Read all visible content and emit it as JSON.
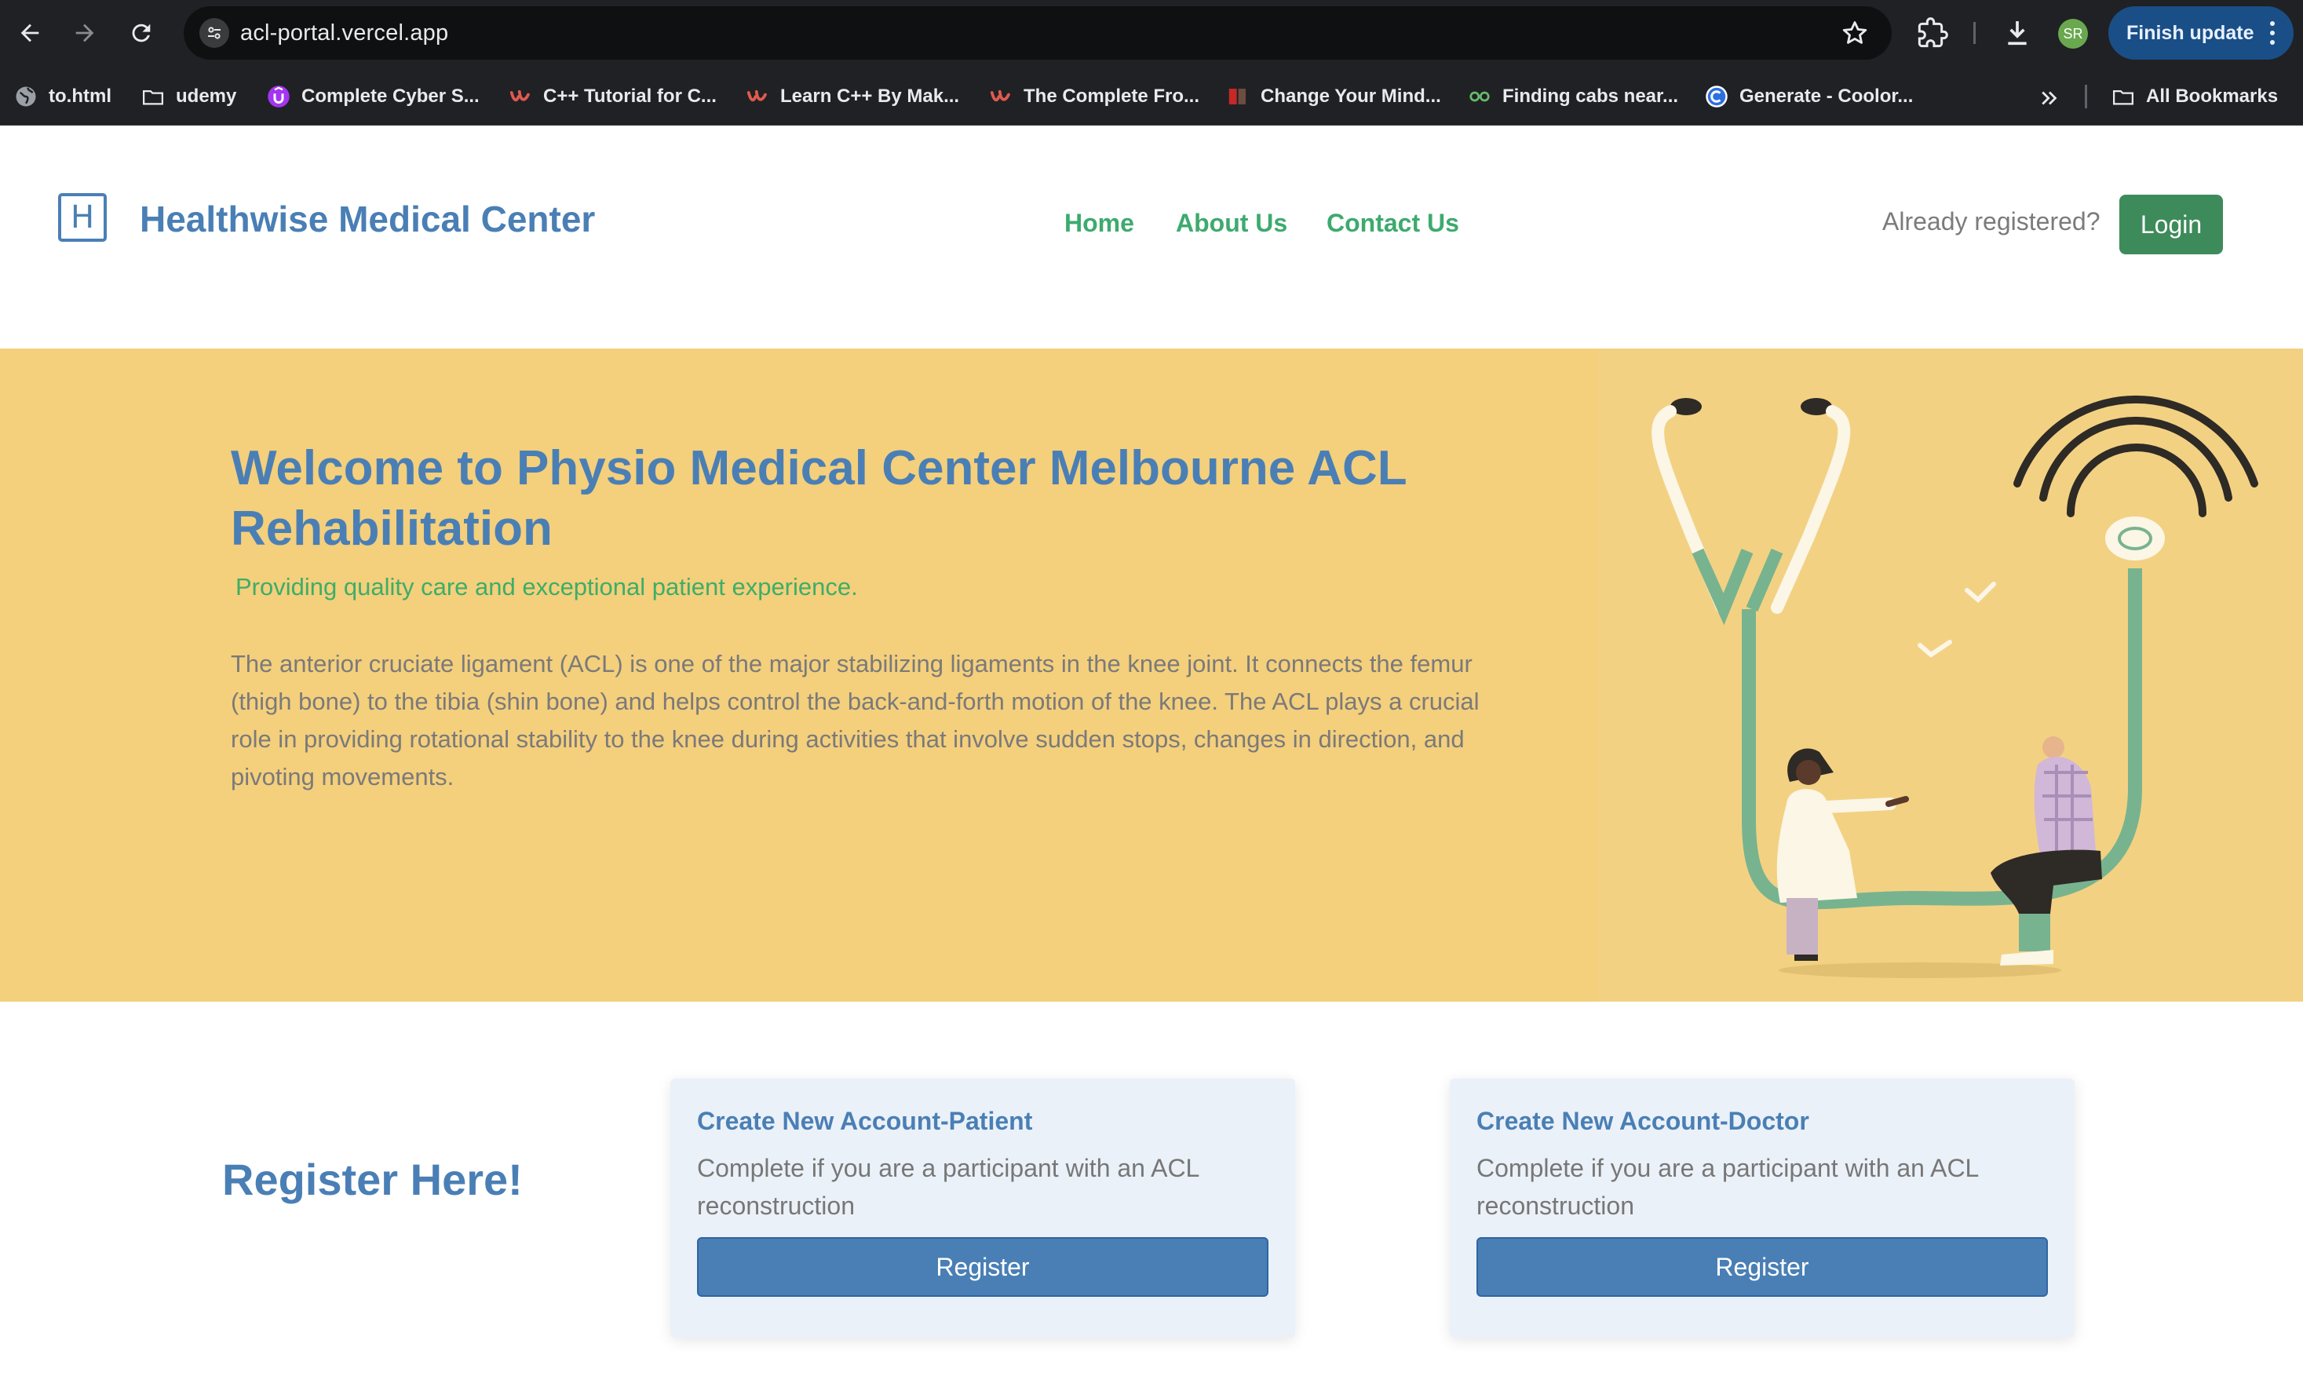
{
  "browser": {
    "url": "acl-portal.vercel.app",
    "profile_initials": "SR",
    "update_button": "Finish update",
    "icons": [
      "back-arrow-icon",
      "forward-arrow-icon",
      "reload-icon",
      "site-settings-icon",
      "star-icon",
      "extensions-icon",
      "download-icon",
      "more-vert-icon"
    ],
    "bookmarks": [
      {
        "label": "to.html",
        "icon": "globe-icon"
      },
      {
        "label": "udemy",
        "icon": "folder-icon"
      },
      {
        "label": "Complete Cyber S...",
        "icon": "udemy-logo-icon"
      },
      {
        "label": "C++ Tutorial for C...",
        "icon": "udemy-u-icon"
      },
      {
        "label": "Learn C++ By Mak...",
        "icon": "udemy-u-icon"
      },
      {
        "label": "The Complete Fro...",
        "icon": "udemy-u-icon"
      },
      {
        "label": "Change Your Mind...",
        "icon": "book-icon"
      },
      {
        "label": "Finding cabs near...",
        "icon": "cab-icon"
      },
      {
        "label": "Generate - Coolor...",
        "icon": "coolors-icon"
      }
    ],
    "all_bookmarks": "All Bookmarks"
  },
  "header": {
    "logo_letter": "H",
    "brand": "Healthwise Medical Center",
    "nav": [
      "Home",
      "About Us",
      "Contact Us"
    ],
    "already_registered": "Already registered?",
    "login": "Login"
  },
  "hero": {
    "title": "Welcome to Physio Medical Center Melbourne ACL Rehabilitation",
    "subtitle": "Providing quality care and exceptional patient experience.",
    "body": "The anterior cruciate ligament (ACL) is one of the major stabilizing ligaments in the knee joint. It connects the femur (thigh bone) to the tibia (shin bone) and helps control the back-and-forth motion of the knee. The ACL plays a crucial role in providing rotational stability to the knee during activities that involve sudden stops, changes in direction, and pivoting movements."
  },
  "register": {
    "heading": "Register Here!",
    "cards": [
      {
        "title": "Create New Account-Patient",
        "text": "Complete if you are a participant with an ACL reconstruction",
        "button": "Register"
      },
      {
        "title": "Create New Account-Doctor",
        "text": "Complete if you are a participant with an ACL reconstruction",
        "button": "Register"
      }
    ]
  },
  "colors": {
    "brand_blue": "#4a7fb5",
    "nav_green": "#3daa6e",
    "login_green": "#3d8b5a",
    "hero_yellow": "#f4cf7c",
    "card_bg": "#ebf1f8"
  }
}
